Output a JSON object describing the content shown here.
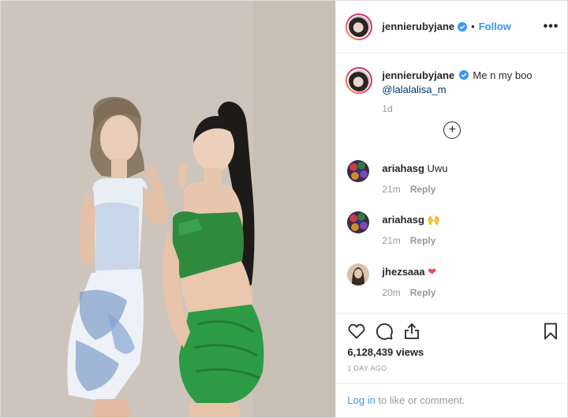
{
  "post": {
    "username": "jennierubyjane",
    "follow_label": "Follow",
    "separator": "•",
    "more_label": "•••",
    "caption_text": "Me n my boo",
    "caption_mention": "@lalalalisa_m",
    "caption_time": "1d",
    "load_more_label": "+"
  },
  "comments": [
    {
      "username": "ariahasg",
      "text": "Uwu",
      "time": "21m",
      "reply": "Reply"
    },
    {
      "username": "ariahasg",
      "text": "🙌",
      "time": "21m",
      "reply": "Reply"
    },
    {
      "username": "jhezsaaa",
      "text": "❤",
      "time": "20m",
      "reply": "Reply"
    }
  ],
  "stats": {
    "views": "6,128,439 views",
    "posted": "1 DAY AGO"
  },
  "footer": {
    "login_link": "Log in",
    "login_rest": " to like or comment."
  },
  "icons": [
    "heart-icon",
    "comment-icon",
    "share-icon",
    "bookmark-icon",
    "verified-badge-icon",
    "add-circle-icon"
  ],
  "colors": {
    "link": "#3897f0",
    "muted": "#999999",
    "text": "#262626",
    "heart": "#ed4956"
  }
}
